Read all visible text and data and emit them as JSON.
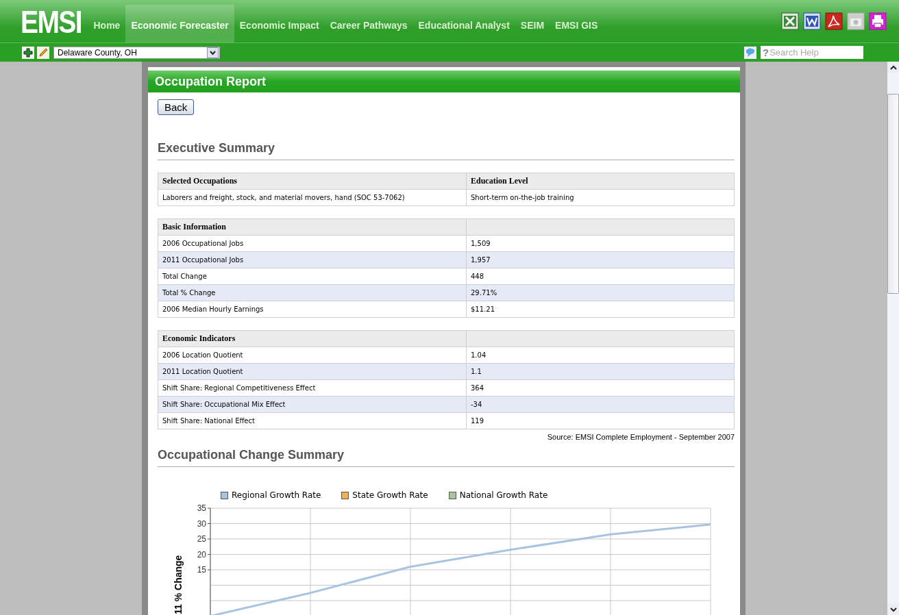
{
  "app": {
    "logo": "EMSI"
  },
  "nav": [
    {
      "label": "Home",
      "selected": false
    },
    {
      "label": "Economic Forecaster",
      "selected": true
    },
    {
      "label": "Economic Impact",
      "selected": false
    },
    {
      "label": "Career Pathways",
      "selected": false
    },
    {
      "label": "Educational Analyst",
      "selected": false
    },
    {
      "label": "SEIM",
      "selected": false
    },
    {
      "label": "EMSI GIS",
      "selected": false
    }
  ],
  "toolbar": {
    "region": "Delaware County, OH",
    "search": {
      "prefix": "?",
      "placeholder": "Search Help"
    }
  },
  "report": {
    "title": "Occupation Report",
    "back_button": "Back",
    "summary_heading": "Executive Summary",
    "tables": [
      {
        "columns": [
          "Selected Occupations",
          "Education Level"
        ],
        "rows": [
          [
            "Laborers and freight, stock, and material movers, hand (SOC 53-7062)",
            "Short-term on-the-job training"
          ]
        ]
      },
      {
        "columns": [
          "Basic Information"
        ],
        "rows": [
          [
            "2006 Occupational Jobs",
            "1,509"
          ],
          [
            "2011 Occupational Jobs",
            "1,957"
          ],
          [
            "Total Change",
            "448"
          ],
          [
            "Total % Change",
            "29.71%"
          ],
          [
            "2006 Median Hourly Earnings",
            "$11.21"
          ]
        ]
      },
      {
        "columns": [
          "Economic Indicators"
        ],
        "rows": [
          [
            "2006 Location Quotient",
            "1.04"
          ],
          [
            "2011 Location Quotient",
            "1.1"
          ],
          [
            "Shift Share: Regional Competitiveness Effect",
            "364"
          ],
          [
            "Shift Share: Occupational Mix Effect",
            "-34"
          ],
          [
            "Shift Share: National Effect",
            "119"
          ]
        ]
      }
    ],
    "source": "Source: EMSI Complete Employment - September 2007",
    "change_heading": "Occupational Change Summary",
    "chart_data": {
      "type": "line",
      "ylabel": "11 % Change",
      "ylim": [
        0,
        35
      ],
      "yticks": [
        15,
        20,
        25,
        30,
        35
      ],
      "grid": true,
      "series": [
        {
          "name": "Regional Growth Rate",
          "color": "#a8c4e0",
          "values": [
            0,
            7.5,
            16,
            21.5,
            26.5,
            29.7
          ]
        },
        {
          "name": "State Growth Rate",
          "color": "#f5b04a",
          "values": [
            null,
            null,
            null,
            null,
            null,
            null
          ]
        },
        {
          "name": "National Growth Rate",
          "color": "#a9c49a",
          "values": [
            null,
            null,
            null,
            null,
            null,
            null
          ]
        }
      ]
    }
  }
}
